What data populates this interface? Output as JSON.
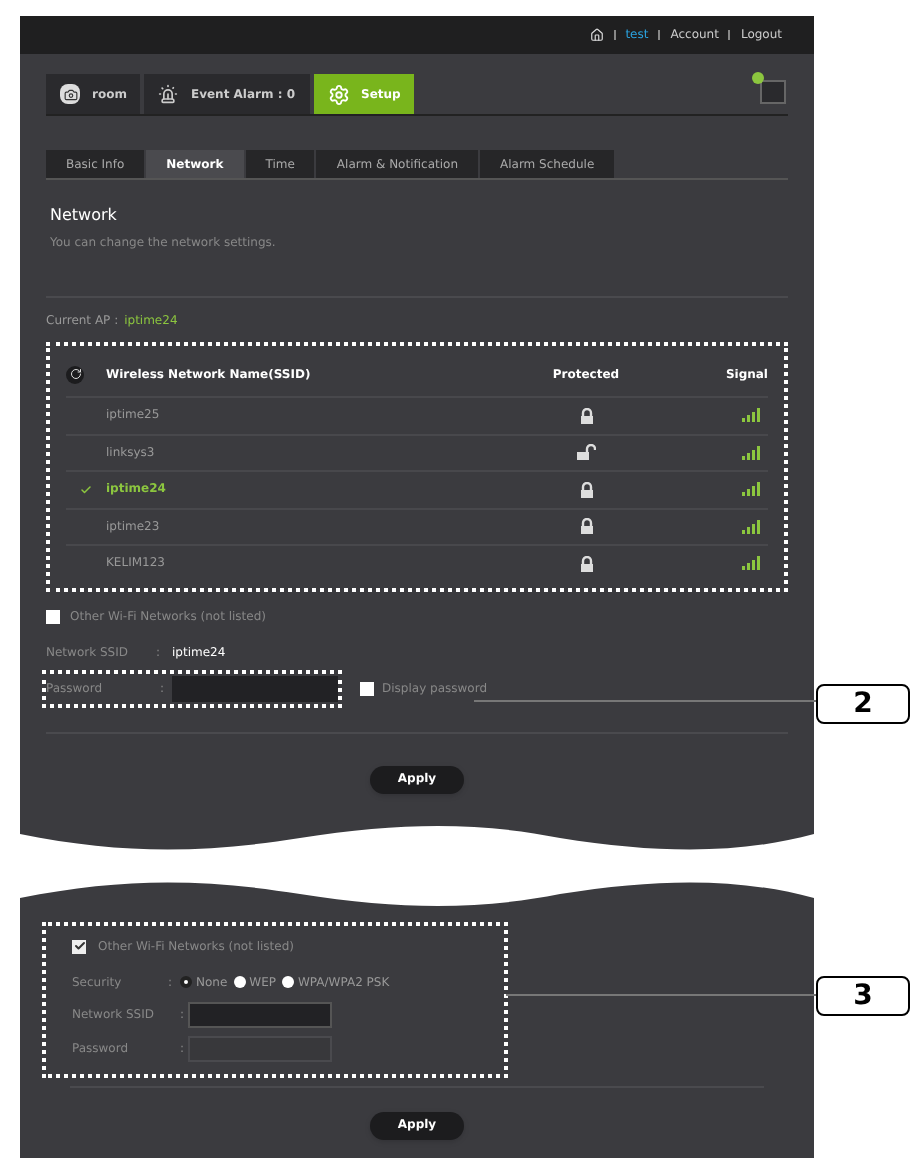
{
  "top_links": {
    "user": "test",
    "account": "Account",
    "logout": "Logout"
  },
  "nav": [
    {
      "label": "room",
      "kind": "camera",
      "selected": false
    },
    {
      "label": "Event Alarm : 0",
      "kind": "alarm",
      "selected": false
    },
    {
      "label": "Setup",
      "kind": "setup",
      "selected": true
    }
  ],
  "tabs": [
    {
      "label": "Basic Info",
      "selected": false
    },
    {
      "label": "Network",
      "selected": true
    },
    {
      "label": "Time",
      "selected": false
    },
    {
      "label": "Alarm & Notification",
      "selected": false
    },
    {
      "label": "Alarm Schedule",
      "selected": false
    }
  ],
  "section": {
    "title": "Network",
    "subtitle": "You can change the network settings."
  },
  "current_ap": {
    "label": "Current AP :",
    "value": "iptime24"
  },
  "network_table": {
    "columns": [
      "Wireless Network Name(SSID)",
      "Protected",
      "Signal"
    ],
    "rows": [
      {
        "ssid": "iptime25",
        "selected": false,
        "protected": true
      },
      {
        "ssid": "linksys3",
        "selected": false,
        "protected": false
      },
      {
        "ssid": "iptime24",
        "selected": true,
        "protected": true
      },
      {
        "ssid": "iptime23",
        "selected": false,
        "protected": true
      },
      {
        "ssid": "KELIM123",
        "selected": false,
        "protected": true
      }
    ]
  },
  "other_networks": {
    "label": "Other Wi-Fi Networks (not listed)",
    "checked": false
  },
  "network_ssid": {
    "label": "Network SSID",
    "separator": ":",
    "value": "iptime24"
  },
  "password": {
    "label": "Password",
    "separator": ":"
  },
  "display_password": {
    "label": "Display password",
    "checked": false
  },
  "apply": "Apply",
  "callouts": [
    "2",
    "3"
  ],
  "lower": {
    "other_networks": {
      "label": "Other Wi-Fi Networks (not listed)",
      "checked": true
    },
    "security": {
      "label": "Security",
      "separator": ":",
      "options": [
        {
          "label": "None",
          "selected": true
        },
        {
          "label": "WEP",
          "selected": false
        },
        {
          "label": "WPA/WPA2 PSK",
          "selected": false
        }
      ]
    },
    "network_ssid": {
      "label": "Network SSID",
      "separator": ":"
    },
    "password": {
      "label": "Password",
      "separator": ":",
      "disabled": true
    },
    "apply": "Apply"
  }
}
